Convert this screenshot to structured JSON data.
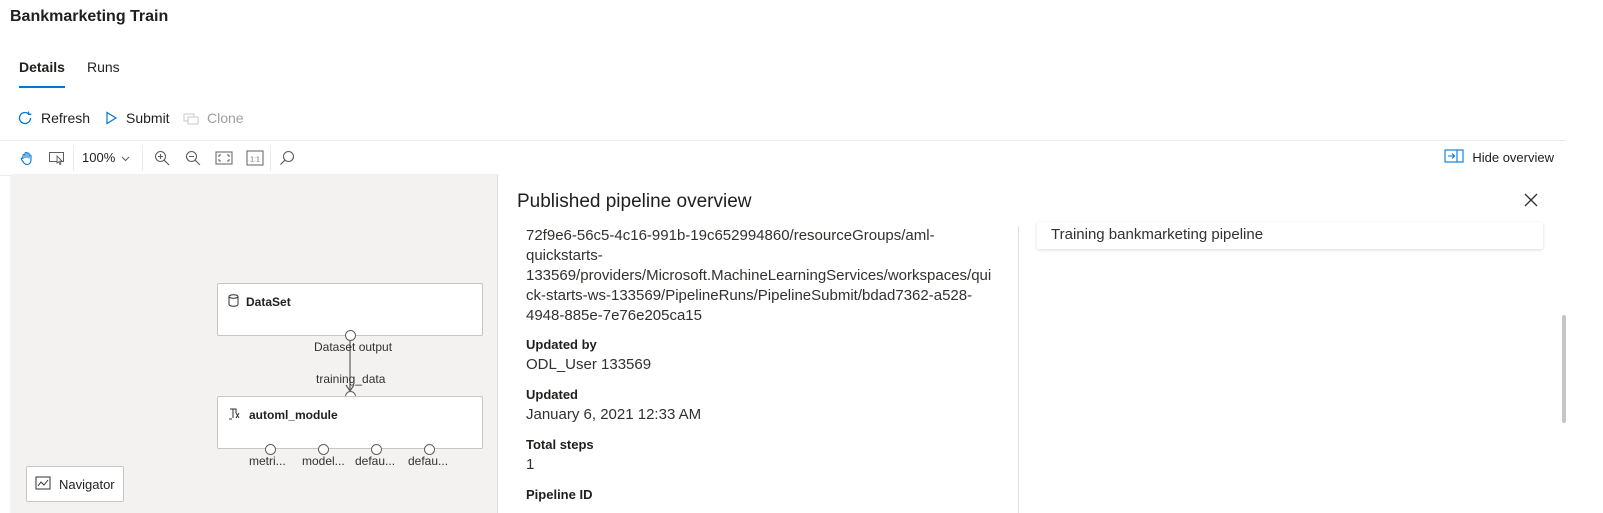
{
  "page": {
    "title": "Bankmarketing Train"
  },
  "tabs": [
    {
      "label": "Details",
      "active": true
    },
    {
      "label": "Runs",
      "active": false
    }
  ],
  "commands": {
    "refresh": "Refresh",
    "submit": "Submit",
    "clone": "Clone"
  },
  "toolbar": {
    "zoom": "100%",
    "hide_overview": "Hide overview",
    "icons": [
      "hand-pan-icon",
      "select-icon",
      "zoom-in-icon",
      "zoom-out-icon",
      "fit-screen-icon",
      "actual-size-icon",
      "search-icon"
    ]
  },
  "canvas": {
    "nodes": [
      {
        "title": "DataSet",
        "icon": "database-icon"
      },
      {
        "title": "automl_module",
        "icon": "module-icon"
      }
    ],
    "ports": {
      "dataset_output": "Dataset output",
      "training_data": "training_data",
      "outputs": [
        "metri...",
        "model...",
        "defau...",
        "defau..."
      ]
    },
    "navigator": "Navigator"
  },
  "overview": {
    "title": "Published pipeline overview",
    "endpoint_lines": [
      "72f9e6-56c5-4c16-991b-19c652994860/resourceGroups/aml-",
      "quickstarts-",
      "133569/providers/Microsoft.MachineLearningServices/workspaces/qui",
      "ck-starts-ws-133569/PipelineRuns/PipelineSubmit/bdad7362-a528-",
      "4948-885e-7e76e205ca15"
    ],
    "updated_by": {
      "label": "Updated by",
      "value": "ODL_User 133569"
    },
    "updated": {
      "label": "Updated",
      "value": "January 6, 2021 12:33 AM"
    },
    "total_steps": {
      "label": "Total steps",
      "value": "1"
    },
    "pipeline_id": {
      "label": "Pipeline ID"
    },
    "description": "Training bankmarketing pipeline"
  },
  "colors": {
    "accent": "#0078d4",
    "canvas_bg": "#f3f2f1"
  }
}
